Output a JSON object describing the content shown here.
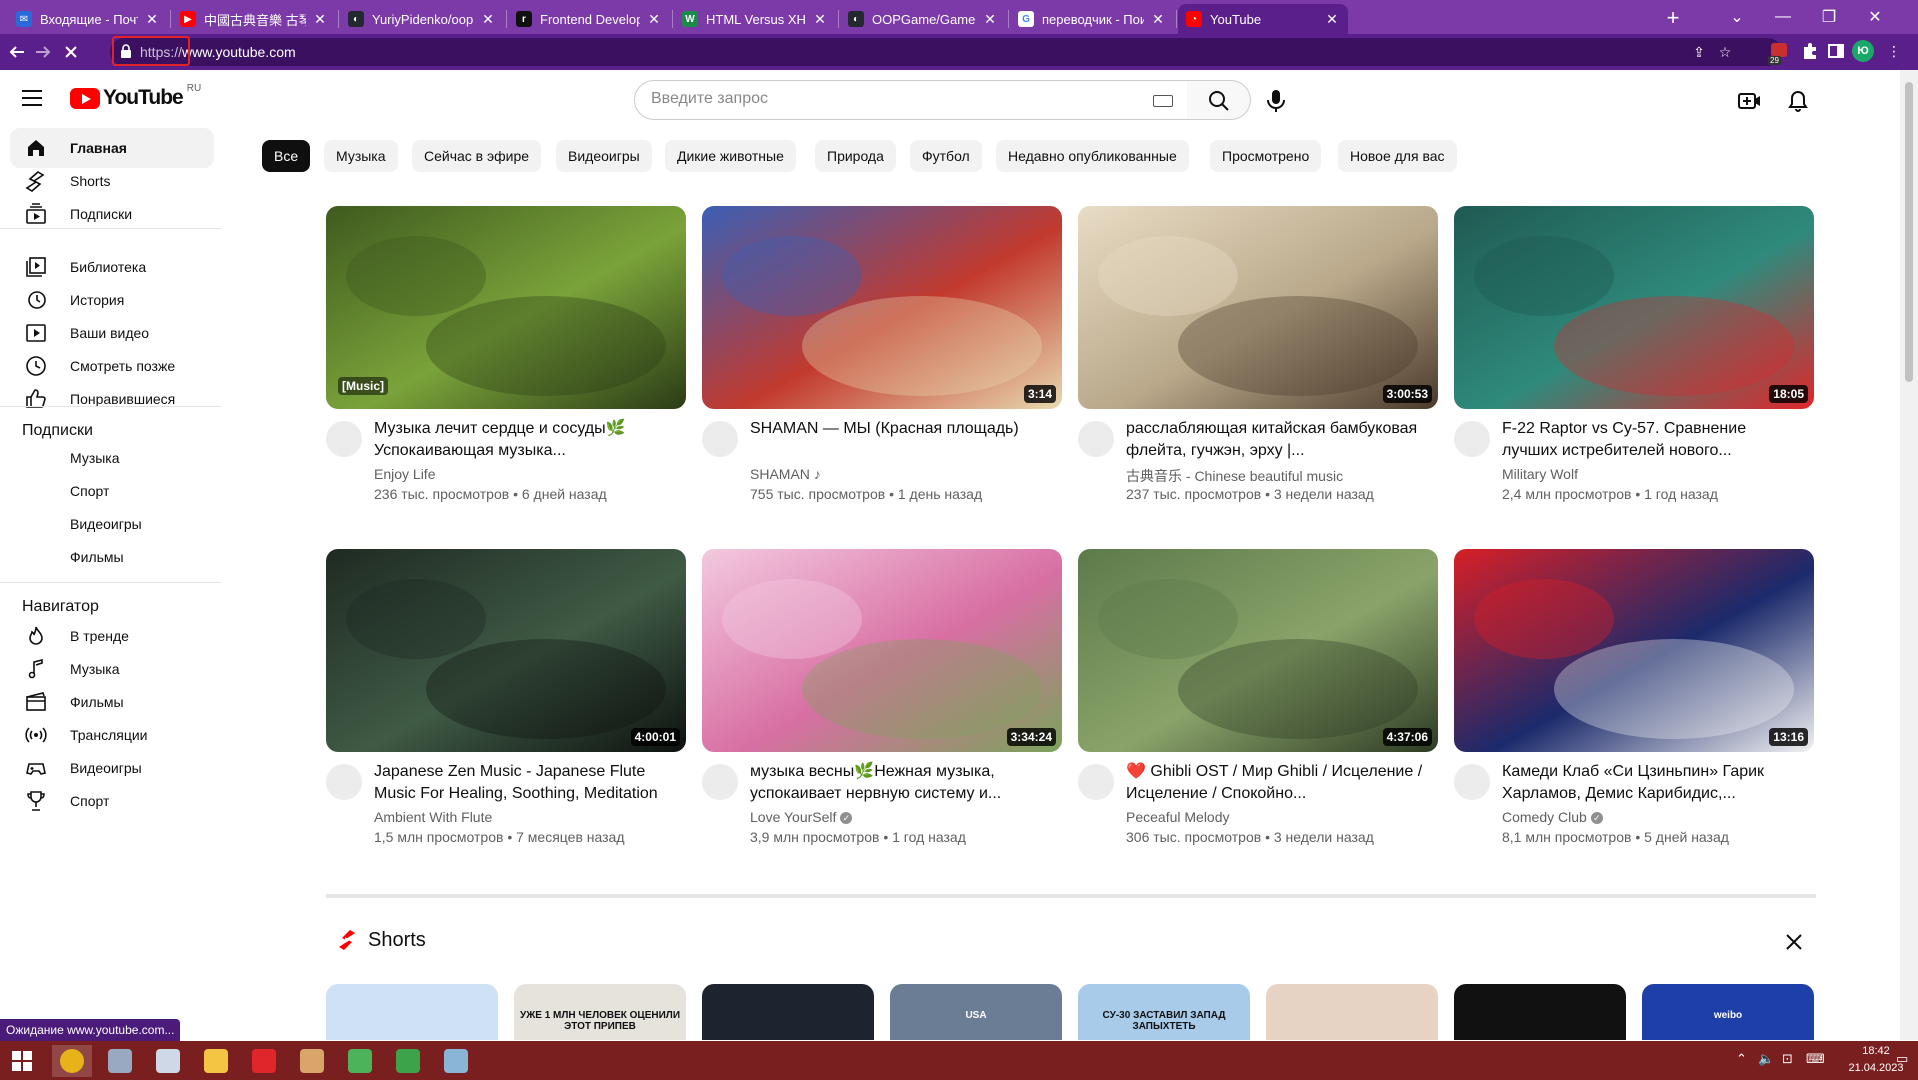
{
  "browser": {
    "tabs": [
      {
        "label": "Входящие - Почта Mail.ru",
        "favicon_color": "#2a6ad8",
        "favicon_glyph": "✉",
        "active": false
      },
      {
        "label": "中國古典音樂 古琴輕音樂 ",
        "favicon_color": "#ff0000",
        "favicon_glyph": "▶",
        "active": false
      },
      {
        "label": "YuriyPidenko/oopDZ",
        "favicon_color": "#24292f",
        "favicon_glyph": "◐",
        "active": false
      },
      {
        "label": "Frontend Developer Road",
        "favicon_color": "#111111",
        "favicon_glyph": "r",
        "active": false
      },
      {
        "label": "HTML Versus XHTML",
        "favicon_color": "#1b8a4a",
        "favicon_glyph": "W",
        "active": false
      },
      {
        "label": "OOPGame/GameOOP at m",
        "favicon_color": "#24292f",
        "favicon_glyph": "◐",
        "active": false
      },
      {
        "label": "переводчик - Поиск в Go",
        "favicon_color": "#ffffff",
        "favicon_glyph": "G",
        "active": false
      },
      {
        "label": "YouTube",
        "favicon_color": "#ff0000",
        "favicon_glyph": "◔",
        "active": true
      }
    ],
    "url_scheme": "https://",
    "url_host": "www.youtube.com",
    "extension_badge": "29",
    "profile_initial": "Ю",
    "status_text": "Ожидание www.youtube.com..."
  },
  "youtube": {
    "logo_text": "YouTube",
    "region": "RU",
    "search_placeholder": "Введите запрос",
    "sidebar": {
      "main": [
        {
          "label": "Главная",
          "icon": "home-icon",
          "active": true
        },
        {
          "label": "Shorts",
          "icon": "shorts-icon",
          "active": false
        },
        {
          "label": "Подписки",
          "icon": "subscriptions-icon",
          "active": false
        }
      ],
      "library": [
        {
          "label": "Библиотека",
          "icon": "library-icon"
        },
        {
          "label": "История",
          "icon": "history-icon"
        },
        {
          "label": "Ваши видео",
          "icon": "your-videos-icon"
        },
        {
          "label": "Смотреть позже",
          "icon": "watch-later-icon"
        },
        {
          "label": "Понравившиеся",
          "icon": "like-icon"
        }
      ],
      "subs_heading": "Подписки",
      "subs": [
        "Музыка",
        "Спорт",
        "Видеоигры",
        "Фильмы"
      ],
      "nav_heading": "Навигатор",
      "nav": [
        {
          "label": "В тренде",
          "icon": "trending-icon"
        },
        {
          "label": "Музыка",
          "icon": "music-icon"
        },
        {
          "label": "Фильмы",
          "icon": "film-icon"
        },
        {
          "label": "Трансляции",
          "icon": "live-icon"
        },
        {
          "label": "Видеоигры",
          "icon": "gaming-icon"
        },
        {
          "label": "Спорт",
          "icon": "sport-icon"
        }
      ]
    },
    "chips": [
      "Все",
      "Музыка",
      "Сейчас в эфире",
      "Видеоигры",
      "Дикие животные",
      "Природа",
      "Футбол",
      "Недавно опубликованные",
      "Просмотрено",
      "Новое для вас"
    ],
    "videos": [
      {
        "title": "Музыка лечит сердце и сосуды🌿 Успокаивающая музыка...",
        "channel": "Enjoy Life",
        "meta": "236 тыс. просмотров • 6 дней назад",
        "duration": "",
        "overlay": "[Music]",
        "colors": [
          "#3f5a1e",
          "#7aa33a",
          "#2c3b16"
        ],
        "verified": false,
        "music_note": false
      },
      {
        "title": "SHAMAN — МЫ (Красная площадь)",
        "channel": "SHAMAN",
        "meta": "755 тыс. просмотров • 1 день назад",
        "duration": "3:14",
        "overlay": "",
        "colors": [
          "#3b5fb5",
          "#c23a2e",
          "#e8d9b0"
        ],
        "verified": false,
        "music_note": true
      },
      {
        "title": "расслабляющая китайская бамбуковая флейта, гучжэн, эрху |...",
        "channel": "古典音乐 - Chinese beautiful music",
        "meta": "237 тыс. просмотров • 3 недели назад",
        "duration": "3:00:53",
        "overlay": "",
        "colors": [
          "#e9dcc5",
          "#b9a88a",
          "#4a3a2a"
        ],
        "verified": false,
        "music_note": false
      },
      {
        "title": "F-22 Raptor vs Су-57. Сравнение лучших истребителей нового...",
        "channel": "Military Wolf",
        "meta": "2,4 млн просмотров • 1 год назад",
        "duration": "18:05",
        "overlay": "",
        "colors": [
          "#1f5a52",
          "#2f8a7c",
          "#e0262b"
        ],
        "verified": false,
        "music_note": false
      },
      {
        "title": "Japanese Zen Music - Japanese Flute Music For Healing, Soothing, Meditation",
        "channel": "Ambient With Flute",
        "meta": "1,5 млн просмотров • 7 месяцев назад",
        "duration": "4:00:01",
        "overlay": "",
        "colors": [
          "#1f2a22",
          "#3f5a45",
          "#0d120f"
        ],
        "verified": false,
        "music_note": false
      },
      {
        "title": "музыка весны🌿Нежная музыка, успокаивает нервную систему и...",
        "channel": "Love YourSelf",
        "meta": "3,9 млн просмотров • 1 год назад",
        "duration": "3:34:24",
        "overlay": "",
        "colors": [
          "#f3c9df",
          "#d86fa3",
          "#7aa35a"
        ],
        "verified": true,
        "music_note": false
      },
      {
        "title": "❤️ Ghibli OST / Мир Ghibli / Исцеление / Исцеление / Спокойно...",
        "channel": "Peceaful Melody",
        "meta": "306 тыс. просмотров • 3 недели назад",
        "duration": "4:37:06",
        "overlay": "",
        "colors": [
          "#5d7a4a",
          "#8aa36a",
          "#2e3b24"
        ],
        "verified": false,
        "music_note": false
      },
      {
        "title": "Камеди Клаб «Си Цзиньпин» Гарик Харламов, Демис Карибидис,...",
        "channel": "Comedy Club",
        "meta": "8,1 млн просмотров • 5 дней назад",
        "duration": "13:16",
        "overlay": "",
        "colors": [
          "#d81f26",
          "#1b2a6b",
          "#f2f2f2"
        ],
        "verified": true,
        "music_note": false
      }
    ],
    "shorts_title": "Shorts",
    "shorts": [
      {
        "color": "#cfe1f5",
        "text": ""
      },
      {
        "color": "#e6e2dc",
        "text": "УЖЕ 1 МЛН ЧЕЛОВЕК ОЦЕНИЛИ ЭТОТ ПРИПЕВ"
      },
      {
        "color": "#1d2430",
        "text": ""
      },
      {
        "color": "#6b7d94",
        "text": "USA"
      },
      {
        "color": "#a9cbea",
        "text": "СУ-30 ЗАСТАВИЛ ЗАПАД ЗАПЫХТЕТЬ"
      },
      {
        "color": "#e7d3c4",
        "text": ""
      },
      {
        "color": "#111111",
        "text": ""
      },
      {
        "color": "#1e3fa8",
        "text": "weibo"
      }
    ]
  },
  "taskbar": {
    "apps": [
      {
        "name": "chrome",
        "color": "#e8b21b",
        "active": true
      },
      {
        "name": "app2",
        "color": "#9aa9c2",
        "active": false
      },
      {
        "name": "app3",
        "color": "#cfd8e6",
        "active": false
      },
      {
        "name": "explorer",
        "color": "#f4c542",
        "active": false
      },
      {
        "name": "yandex",
        "color": "#e0262b",
        "active": false
      },
      {
        "name": "app6",
        "color": "#d9a56a",
        "active": false
      },
      {
        "name": "app7",
        "color": "#4db35a",
        "active": false
      },
      {
        "name": "app8",
        "color": "#3da34a",
        "active": false
      },
      {
        "name": "app9",
        "color": "#8ab5d6",
        "active": false
      }
    ],
    "time": "18:42",
    "date": "21.04.2023"
  }
}
